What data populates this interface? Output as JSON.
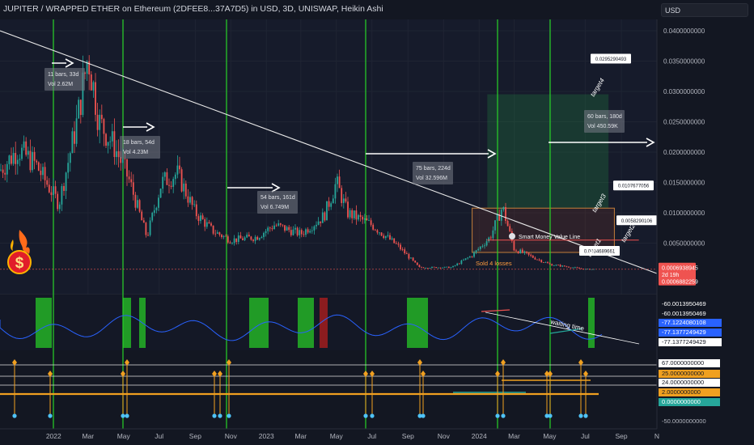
{
  "header": {
    "title": "JUPITER / WRAPPED ETHER on Ethereum (2DFEE8...37A7D5) in USD, 3D, UNISWAP, Heikin Ashi"
  },
  "currency": "USD",
  "colors": {
    "up": "#26a69a",
    "down": "#ef5350",
    "bg": "#131722",
    "grid": "#1f2433",
    "text": "#b2b5be",
    "vline": "#27d327",
    "trend": "#e8e8e8"
  },
  "price_axis": [
    "0.0400000000",
    "0.0350000000",
    "0.0300000000",
    "0.0250000000",
    "0.0200000000",
    "0.0150000000",
    "0.0100000000",
    "0.0050000000"
  ],
  "time_axis": [
    "2022",
    "Mar",
    "May",
    "Jul",
    "Sep",
    "Nov",
    "2023",
    "Mar",
    "May",
    "Jul",
    "Sep",
    "Nov",
    "2024",
    "Mar",
    "May",
    "Jul",
    "Sep",
    "N"
  ],
  "last_price": {
    "price": "0.0006938945",
    "countdown": "2d 19h",
    "alt": "0.0006882259"
  },
  "box_labels": [
    {
      "bars": "11 bars, 33d",
      "vol": "Vol 2.62M"
    },
    {
      "bars": "18 bars, 54d",
      "vol": "Vol 4.23M"
    },
    {
      "bars": "54 bars, 161d",
      "vol": "Vol 6.749M"
    },
    {
      "bars": "75 bars, 224d",
      "vol": "Vol 32.596M"
    },
    {
      "bars": "60 bars, 180d",
      "vol": "Vol 450.59K"
    }
  ],
  "targets": [
    {
      "name": "target1",
      "value": "0.0034689661"
    },
    {
      "name": "target2",
      "value": "0.0058290106"
    },
    {
      "name": "target3",
      "value": "0.0107677056"
    },
    {
      "name": "target4",
      "value": "0.0295290493"
    }
  ],
  "annotations": {
    "smart_money": "Smart Money Value Line",
    "sold": "Sold 4 losses",
    "waiting": "waiting time"
  },
  "osc_axis": [
    "-60.0013950469",
    "-60.0013950469",
    "-77.1224080108",
    "-77.1377249429",
    "-77.1377249429"
  ],
  "ind_axis": [
    "67.0000000000",
    "25.0000000000",
    "24.0000000000",
    "2.0000000000",
    "0.0000000000",
    "-50.0000000000"
  ],
  "chart_data": {
    "type": "candlestick",
    "title": "JUPITER / WRAPPED ETHER on Ethereum (2DFEE8...37A7D5) in USD, 3D, UNISWAP, Heikin Ashi",
    "y_axis_range": [
      0,
      0.042
    ],
    "x_range": [
      "2021-10-01",
      "2024-11-01"
    ],
    "close_series": [
      [
        "2021-10-01",
        0.017
      ],
      [
        "2021-11-01",
        0.0205
      ],
      [
        "2021-12-01",
        0.018
      ],
      [
        "2022-01-10",
        0.0115
      ],
      [
        "2022-02-10",
        0.025
      ],
      [
        "2022-03-01",
        0.036
      ],
      [
        "2022-03-20",
        0.025
      ],
      [
        "2022-04-15",
        0.021
      ],
      [
        "2022-05-10",
        0.0155
      ],
      [
        "2022-06-10",
        0.006
      ],
      [
        "2022-07-05",
        0.015
      ],
      [
        "2022-08-01",
        0.0165
      ],
      [
        "2022-09-01",
        0.01
      ],
      [
        "2022-10-01",
        0.007
      ],
      [
        "2022-11-01",
        0.0055
      ],
      [
        "2022-12-15",
        0.006
      ],
      [
        "2023-01-15",
        0.008
      ],
      [
        "2023-03-01",
        0.0065
      ],
      [
        "2023-04-10",
        0.0095
      ],
      [
        "2023-05-01",
        0.015
      ],
      [
        "2023-05-20",
        0.01
      ],
      [
        "2023-07-01",
        0.008
      ],
      [
        "2023-08-15",
        0.0045
      ],
      [
        "2023-09-20",
        0.001
      ],
      [
        "2023-11-15",
        0.001
      ],
      [
        "2023-12-20",
        0.003
      ],
      [
        "2024-01-20",
        0.006
      ],
      [
        "2024-02-10",
        0.011
      ],
      [
        "2024-03-01",
        0.004
      ],
      [
        "2024-05-01",
        0.0015
      ],
      [
        "2024-07-01",
        0.0007
      ]
    ],
    "trendline": {
      "from": [
        "2021-10-01",
        0.04
      ],
      "to": [
        "2024-11-01",
        0.0
      ]
    },
    "smart_money_value_line": 0.0055,
    "last_price": 0.0006938945,
    "targets": [
      0.0034689661,
      0.0058290106,
      0.0107677056,
      0.0295290493
    ]
  }
}
